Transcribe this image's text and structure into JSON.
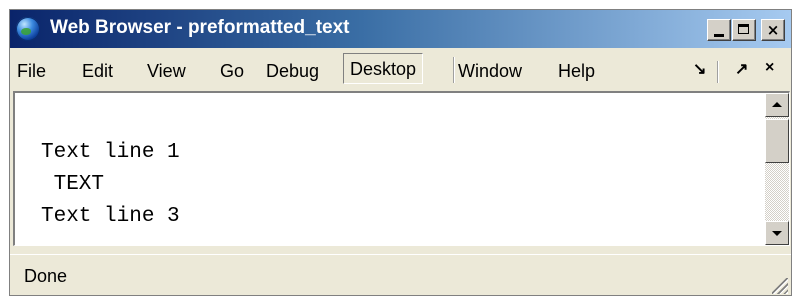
{
  "window": {
    "title": "Web Browser - preformatted_text",
    "buttons": {
      "minimize": "",
      "maximize": "",
      "close": "×"
    }
  },
  "menu": {
    "items": [
      {
        "label": "File"
      },
      {
        "label": "Edit"
      },
      {
        "label": "View"
      },
      {
        "label": "Go"
      },
      {
        "label": "Debug"
      },
      {
        "label": "Desktop"
      },
      {
        "label": "Window"
      },
      {
        "label": "Help"
      }
    ],
    "mdi": {
      "restore": "↘",
      "float": "↗",
      "close": "×"
    }
  },
  "content": {
    "preformatted_text": "Text line 1\n TEXT\nText line 3"
  },
  "status": {
    "text": "Done"
  },
  "icons": [
    "browser-globe-icon",
    "minimize-icon",
    "maximize-icon",
    "close-icon",
    "scroll-up-arrow-icon",
    "scroll-down-arrow-icon",
    "resize-grip-icon"
  ]
}
